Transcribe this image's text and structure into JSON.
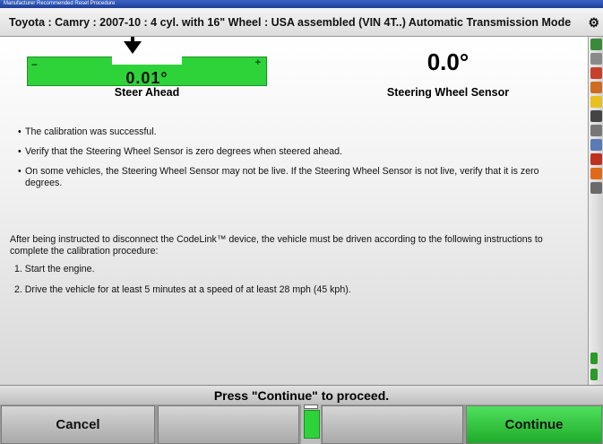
{
  "window": {
    "title": "Manufacturer Recommended Reset Procedure",
    "vehicle": "Toyota : Camry : 2007-10 : 4 cyl. with 16\" Wheel : USA assembled (VIN 4T..) Automatic Transmission Mode",
    "settings_icon": "gear-icon"
  },
  "readings": {
    "steer_ahead_value": "0.01°",
    "steer_ahead_label": "Steer Ahead",
    "meter_minus": "−",
    "meter_plus": "+",
    "sensor_value": "0.0°",
    "sensor_label": "Steering Wheel Sensor"
  },
  "bullets": [
    "The calibration was successful.",
    "Verify that the Steering Wheel Sensor is zero degrees when steered ahead.",
    "On some vehicles, the Steering Wheel Sensor may not be live. If the Steering Wheel Sensor is not live, verify that it is zero degrees."
  ],
  "bullet_marker": "•",
  "instructions": "After being instructed to disconnect the CodeLink™ device, the vehicle must be driven according to the following instructions to complete the calibration procedure:",
  "steps": [
    "1.  Start the engine.",
    "2.  Drive the vehicle for at least 5 minutes at a speed of at least 28 mph (45 kph)."
  ],
  "prompt": "Press \"Continue\" to proceed.",
  "buttons": {
    "cancel": "Cancel",
    "blank1": "",
    "blank2": "",
    "continue": "Continue"
  },
  "colors": {
    "meter_green": "#2ed33a",
    "continue_green": "#1fab2a",
    "title_blue": "#1f3f96"
  }
}
